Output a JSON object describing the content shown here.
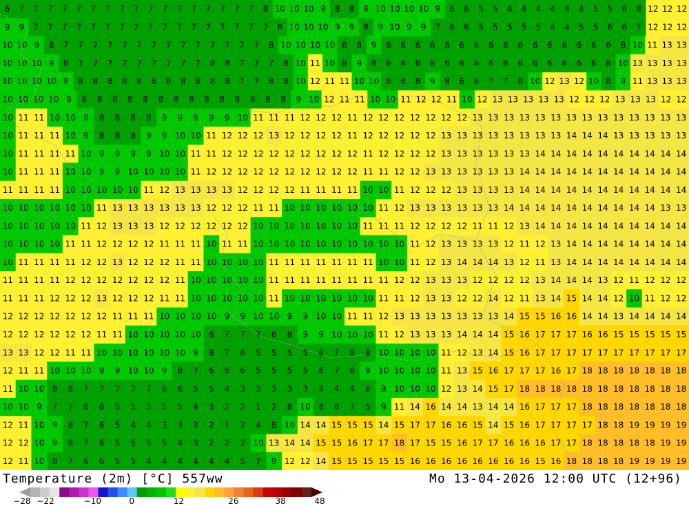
{
  "footer": {
    "title": "Temperature (2m) [°C] 557ww",
    "datetime": "Mo 13-04-2026 12:00 UTC (12+96)"
  },
  "legend": {
    "ticks": [
      "-28",
      "-22",
      "-10",
      "0",
      "12",
      "26",
      "38",
      "48"
    ],
    "colors": [
      "#9c9c9c",
      "#b4b4b4",
      "#cdcdcd",
      "#e6e6e6",
      "#8a0b8a",
      "#b01ab0",
      "#d22ed2",
      "#ee55ee",
      "#1414c8",
      "#1e50f0",
      "#3c8cff",
      "#5ac8ff",
      "#00a000",
      "#00b400",
      "#00c800",
      "#1edc1e",
      "#ffff00",
      "#fff032",
      "#f5e646",
      "#ffd700",
      "#ffbe28",
      "#ffa03c",
      "#f08232",
      "#e6641e",
      "#dc3c14",
      "#cd0000",
      "#b40000",
      "#9b0000",
      "#820000",
      "#641e1e",
      "#4b0000"
    ]
  },
  "map": {
    "colors": {
      "t_le8": "#00a000",
      "t_9_10": "#00c800",
      "t_11_12": "#fff032",
      "t_13_14": "#f5e646",
      "t_15_17": "#ffd700",
      "t_ge18": "#ffbe28"
    },
    "temperature_rows": [
      "6 7 7 7 7 7 7 7 7 7 7 7 7 7 7 7 7 7 8 10 10 10 9 8 8 9 10 10 10 10 9 6 6 5 5 4 4 4 4 4 4 5 5 6 8 12 12 12",
      "9 9 7 7 7 7 7 7 7 7 7 7 7 7 7 7 7 7 7 8 10 10 10 9 9 8 9 10 9 9 7 6 6 5 5 5 5 5 4 4 5 5 6 6 7 12 12 12",
      "10 10 9 8 7 7 7 7 7 7 7 7 7 7 7 7 7 7 8 10 10 10 10 8 8 9 8 6 6 6 6 6 6 6 6 6 6 6 6 6 6 6 8 10 11 13 13",
      "10 10 10 9 8 7 7 7 7 7 7 7 7 7 8 8 7 7 7 8 10 11 10 8 9 8 6 6 6 6 6 6 6 6 6 6 6 6 6 6 6 8 10 13 13 13 13",
      "10 10 10 10 9 8 8 8 8 8 8 8 8 8 8 8 7 7 8 8 10 12 11 11 10 10 8 8 8 9 8 6 6 7 7 8 10 12 13 12 10 8 9 11 13 13 13",
      "10 10 10 10 9 8 8 8 8 8 8 8 8 8 8 8 8 8 8 9 10 12 11 11 10 10 11 12 12 11 10 12 13 13 13 13 13 12 12 12 13 13 13 12 12",
      "10 11 11 10 10 9 8 8 8 8 9 9 9 9 9 10 11 11 11 12 12 12 11 12 12 12 12 12 12 12 13 13 13 13 13 13 13 13 13 13 13 13 13 13",
      "10 11 11 11 10 9 8 8 8 9 9 10 10 11 12 12 12 13 12 12 12 12 11 12 12 12 12 12 13 13 13 13 13 13 13 13 14 14 14 13 13 13 13 13",
      "10 11 11 11 11 10 9 9 9 9 10 10 11 11 12 12 12 12 12 12 12 12 12 11 12 12 12 12 13 13 13 13 13 13 14 14 14 14 14 14 14 14 14 14",
      "10 11 11 11 10 10 9 9 10 10 10 10 11 12 12 12 12 12 12 12 12 12 12 11 11 12 12 13 13 13 13 13 13 14 14 14 14 14 14 14 14 14 14 14",
      "11 11 11 11 10 10 10 10 10 11 12 13 13 13 13 12 12 12 12 11 11 11 11 10 10 11 12 12 12 13 13 13 13 14 14 14 14 14 14 14 14 14 14 14",
      "10 10 10 10 10 10 11 13 13 13 13 13 13 12 12 12 11 11 10 10 10 10 10 10 11 12 13 13 13 13 13 13 14 14 14 14 14 14 14 14 14 14 13 13",
      "10 10 10 10 10 11 12 13 13 13 12 12 12 12 12 12 10 10 10 10 10 10 10 11 11 11 12 12 12 12 11 11 12 13 14 14 14 14 14 14 14 14 14 14",
      "10 10 10 10 11 11 12 12 12 12 11 11 11 10 11 11 10 10 10 10 10 10 10 10 10 10 11 12 13 13 13 13 12 11 12 13 14 14 14 14 14 14 14 14",
      "10 11 11 11 11 12 12 13 12 12 12 11 11 10 10 10 10 11 11 11 11 11 11 11 10 10 11 12 13 14 14 14 13 12 11 13 14 14 14 14 14 14 14 14",
      "11 11 11 11 12 12 12 12 12 12 12 11 10 10 10 10 10 11 11 11 11 11 11 11 11 12 12 13 13 13 12 12 12 12 13 14 14 14 13 12 11 12 12 12",
      "11 11 11 12 12 12 13 12 12 12 11 11 10 10 10 10 10 11 10 10 10 10 10 10 11 11 12 13 13 12 12 14 12 11 13 14 15 14 14 12 10 11 12 12",
      "12 12 12 12 12 12 12 11 11 11 10 10 10 10 9 9 10 10 9 9 10 10 11 11 12 13 13 13 13 13 13 13 14 15 15 16 16 14 14 13 14 14 14 14",
      "12 12 12 12 12 12 11 11 10 10 10 10 10 8 7 7 7 6 8 9 9 10 10 10 11 12 13 13 13 14 14 14 15 16 17 17 17 16 16 15 15 15 15 15",
      "13 13 12 12 11 11 10 10 10 10 10 10 9 8 7 6 5 5 5 5 6 7 8 8 10 10 10 10 11 12 13 14 15 16 17 17 17 17 17 17 17 17 17 17",
      "12 11 11 10 10 10 9 9 10 10 9 8 7 6 6 6 5 5 5 5 6 7 8 9 10 10 10 10 11 13 15 16 17 17 17 16 17 18 18 18 18 18 18 18",
      "11 10 10 8 8 7 7 7 7 7 6 6 5 5 4 3 3 3 3 3 4 4 4 6 9 10 10 10 12 13 14 15 17 18 18 18 18 18 18 18 18 18 18 18",
      "10 10 9 7 7 6 6 5 5 5 5 5 4 3 2 2 1 2 8 10 8 8 7 5 9 11 14 16 14 14 13 14 14 16 17 17 17 18 18 18 18 18 18 18",
      "12 11 10 9 8 7 6 5 4 4 3 3 2 2 1 2 4 8 10 14 14 15 15 15 14 15 17 17 16 16 15 14 15 16 17 17 17 17 18 18 19 19 19 19",
      "12 12 10 9 8 7 6 5 5 5 5 4 3 2 2 2 10 13 14 14 15 15 16 17 17 18 17 15 15 16 17 17 16 16 16 17 17 18 18 18 18 18 19 19",
      "12 11 10 8 7 6 6 5 5 4 4 4 4 4 4 5 7 9 12 12 14 15 15 15 15 15 16 16 16 16 16 16 16 16 15 16 18 18 18 18 19 19 19 19"
    ]
  }
}
